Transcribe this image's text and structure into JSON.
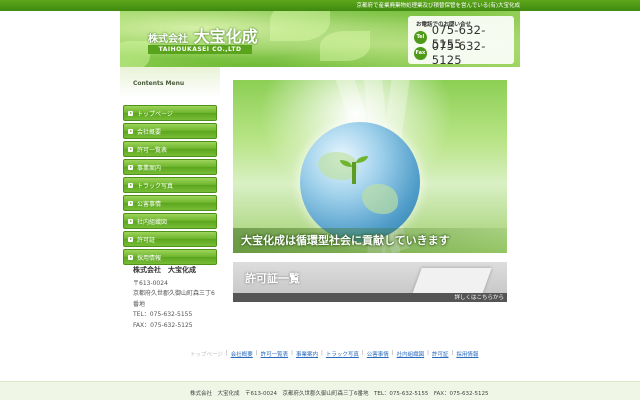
{
  "topbar": {
    "tagline": "京都府で産業廃棄物処理業及び積替保管を営んでいる(有)大宝化成"
  },
  "header": {
    "company_prefix": "株式会社",
    "company_name": "大宝化成",
    "company_en": "TAIHOUKASEI CO.,LTD",
    "contact_title": "お電話でのお問い合せ",
    "tel_label": "Tel",
    "tel": "075-632-5155",
    "fax_label": "Fax",
    "fax": "075-632-5125"
  },
  "sidebar": {
    "menu_title": "Contents Menu",
    "items": [
      {
        "label": "トップページ"
      },
      {
        "label": "会社概要"
      },
      {
        "label": "許可一覧表"
      },
      {
        "label": "事業案内"
      },
      {
        "label": "トラック写真"
      },
      {
        "label": "公害事情"
      },
      {
        "label": "社内組織図"
      },
      {
        "label": "許可証"
      },
      {
        "label": "採用情報"
      }
    ],
    "info": {
      "name": "株式会社　大宝化成",
      "zip": "〒613-0024",
      "address1": "京都府久世郡久御山町森三丁6",
      "address2": "番地",
      "tel": "TEL：075-632-5155",
      "fax": "FAX：075-632-5125"
    }
  },
  "main": {
    "hero_caption": "大宝化成は循環型社会に貢献していきます",
    "banner_title": "許可証一覧",
    "banner_more": "詳しくはこちらから"
  },
  "footer_nav": [
    {
      "label": "トップページ"
    },
    {
      "label": "会社概要"
    },
    {
      "label": "許可一覧表"
    },
    {
      "label": "事業案内"
    },
    {
      "label": "トラック写真"
    },
    {
      "label": "公害事情"
    },
    {
      "label": "社内組織図"
    },
    {
      "label": "許可証"
    },
    {
      "label": "採用情報"
    }
  ],
  "footer_info": "株式会社　大宝化成　〒613-0024　京都府久世郡久御山町森三丁6番地　TEL：075-632-5155　FAX：075-632-5125",
  "colors": {
    "accent": "#5ba61e",
    "link": "#2a6bbf",
    "header_bg": "#6bb833"
  }
}
